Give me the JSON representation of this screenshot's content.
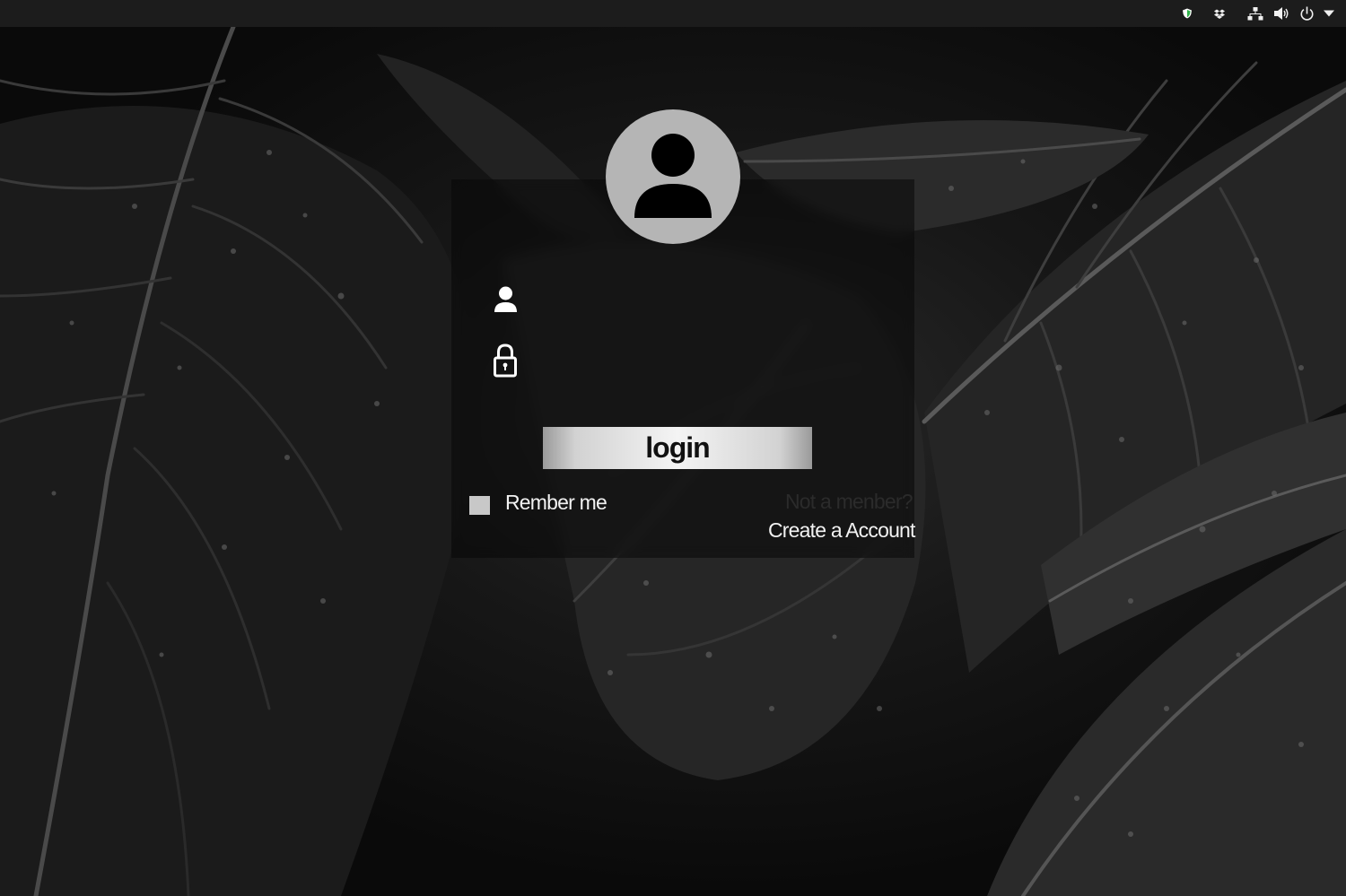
{
  "system_tray": {
    "icons": [
      "shield-icon",
      "dropbox-icon",
      "network-icon",
      "volume-icon",
      "power-icon",
      "menu-arrow-icon"
    ]
  },
  "login": {
    "username_placeholder": "",
    "password_placeholder": "",
    "button_label": "login",
    "remember_label": "Rember me",
    "not_member_text": "Not a menber?",
    "create_account_link": "Create a Account"
  },
  "colors": {
    "avatar_bg": "#b5b5b5",
    "panel_bg": "#080808",
    "topbar_bg": "#1c1c1c",
    "tray_shield": "#2fb34a"
  }
}
